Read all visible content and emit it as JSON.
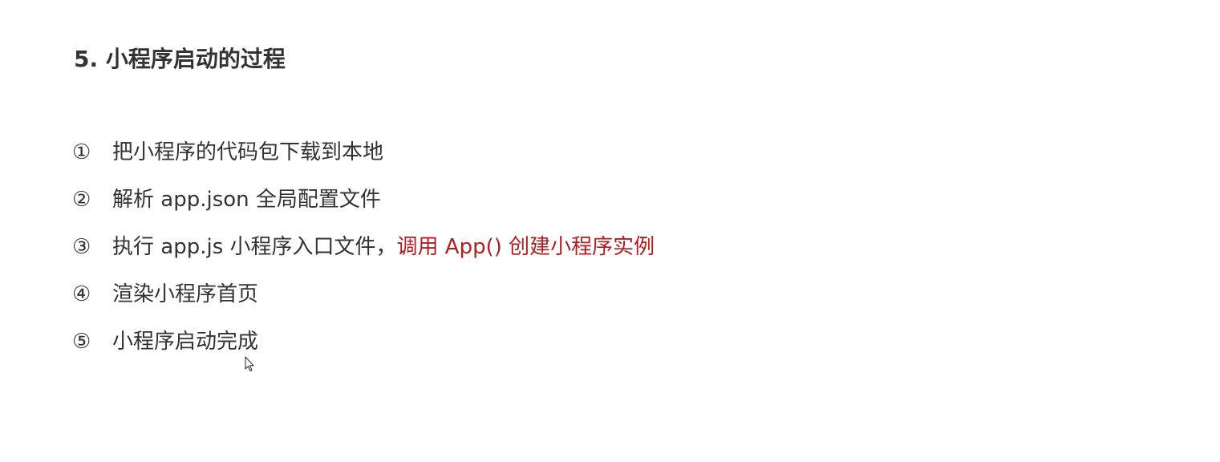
{
  "title": "5. 小程序启动的过程",
  "steps": [
    {
      "marker": "①",
      "text": "把小程序的代码包下载到本地",
      "highlight": ""
    },
    {
      "marker": "②",
      "text": "解析 app.json 全局配置文件",
      "highlight": ""
    },
    {
      "marker": "③",
      "text": "执行 app.js 小程序入口文件，",
      "highlight": "调用 App() 创建小程序实例"
    },
    {
      "marker": "④",
      "text": "渲染小程序首页",
      "highlight": ""
    },
    {
      "marker": "⑤",
      "text": "小程序启动完成",
      "highlight": ""
    }
  ],
  "colors": {
    "text": "#333333",
    "highlight": "#b11e22",
    "background": "#ffffff"
  },
  "icons": {
    "cursor": "mouse-pointer-icon"
  }
}
